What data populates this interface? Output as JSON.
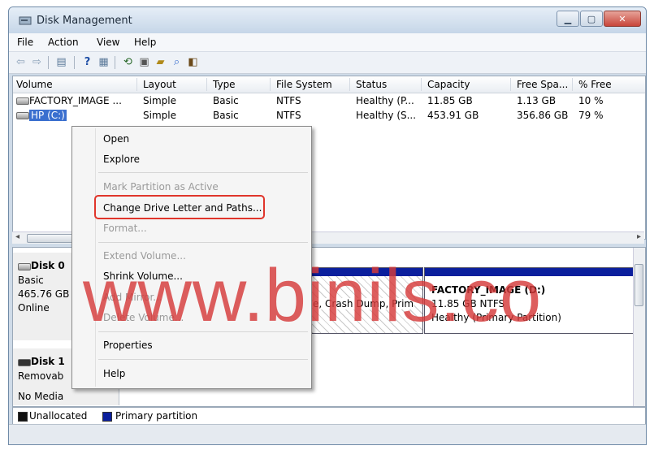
{
  "window": {
    "title": "Disk Management"
  },
  "menu": [
    "File",
    "Action",
    "View",
    "Help"
  ],
  "toolbar_icons": [
    "back-icon",
    "forward-icon",
    "properties-icon",
    "help-icon",
    "list-icon",
    "refresh-icon",
    "rescan-icon",
    "explore-icon",
    "open-icon",
    "disk-icon"
  ],
  "columns": [
    "Volume",
    "Layout",
    "Type",
    "File System",
    "Status",
    "Capacity",
    "Free Spa...",
    "% Free"
  ],
  "rows": [
    {
      "volume": "FACTORY_IMAGE ...",
      "layout": "Simple",
      "type": "Basic",
      "fs": "NTFS",
      "status": "Healthy (P...",
      "capacity": "11.85 GB",
      "free": "1.13 GB",
      "pct": "10 %"
    },
    {
      "volume": "HP (C:)",
      "layout": "Simple",
      "type": "Basic",
      "fs": "NTFS",
      "status": "Healthy (S...",
      "capacity": "453.91 GB",
      "free": "356.86 GB",
      "pct": "79 %"
    }
  ],
  "disk0": {
    "name": "Disk 0",
    "type": "Basic",
    "size": "465.76 GB",
    "state": "Online"
  },
  "partition_c": {
    "detail": "e, Crash Dump, Prim"
  },
  "partition_d": {
    "name": "FACTORY_IMAGE (D:)",
    "size": "11.85 GB NTFS",
    "status": "Healthy (Primary Partition)"
  },
  "disk1": {
    "name": "Disk 1",
    "type": "Removab",
    "state": "No Media"
  },
  "legend": {
    "unallocated": "Unallocated",
    "primary": "Primary partition"
  },
  "context_menu": {
    "open": "Open",
    "explore": "Explore",
    "mark_active": "Mark Partition as Active",
    "change_letter": "Change Drive Letter and Paths...",
    "format": "Format...",
    "extend": "Extend Volume...",
    "shrink": "Shrink Volume...",
    "add_mirror": "Add Mirror...",
    "delete": "Delete Volume...",
    "properties": "Properties",
    "help": "Help"
  },
  "watermark": "www.binils.co",
  "colors": {
    "primary_partition": "#0b1f9d",
    "highlight": "#e0352b",
    "selection": "#3a6fcf"
  }
}
